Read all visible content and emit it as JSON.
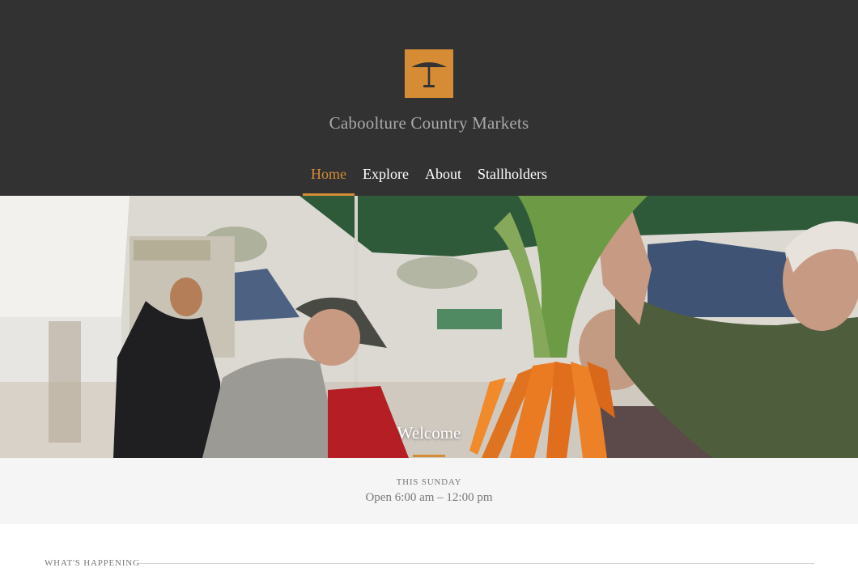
{
  "site": {
    "title": "Caboolture Country Markets",
    "logo_icon": "market-umbrella-icon",
    "accent_color": "#d58c35",
    "header_bg": "#323232"
  },
  "nav": {
    "items": [
      {
        "label": "Home",
        "active": true
      },
      {
        "label": "Explore",
        "active": false
      },
      {
        "label": "About",
        "active": false
      },
      {
        "label": "Stallholders",
        "active": false
      }
    ]
  },
  "hero": {
    "title": "Welcome",
    "image_subject": "farmer holding carrots at market"
  },
  "hours": {
    "label": "This Sunday",
    "text": "Open 6:00 am – 12:00 pm"
  },
  "section": {
    "heading": "What's Happening"
  }
}
